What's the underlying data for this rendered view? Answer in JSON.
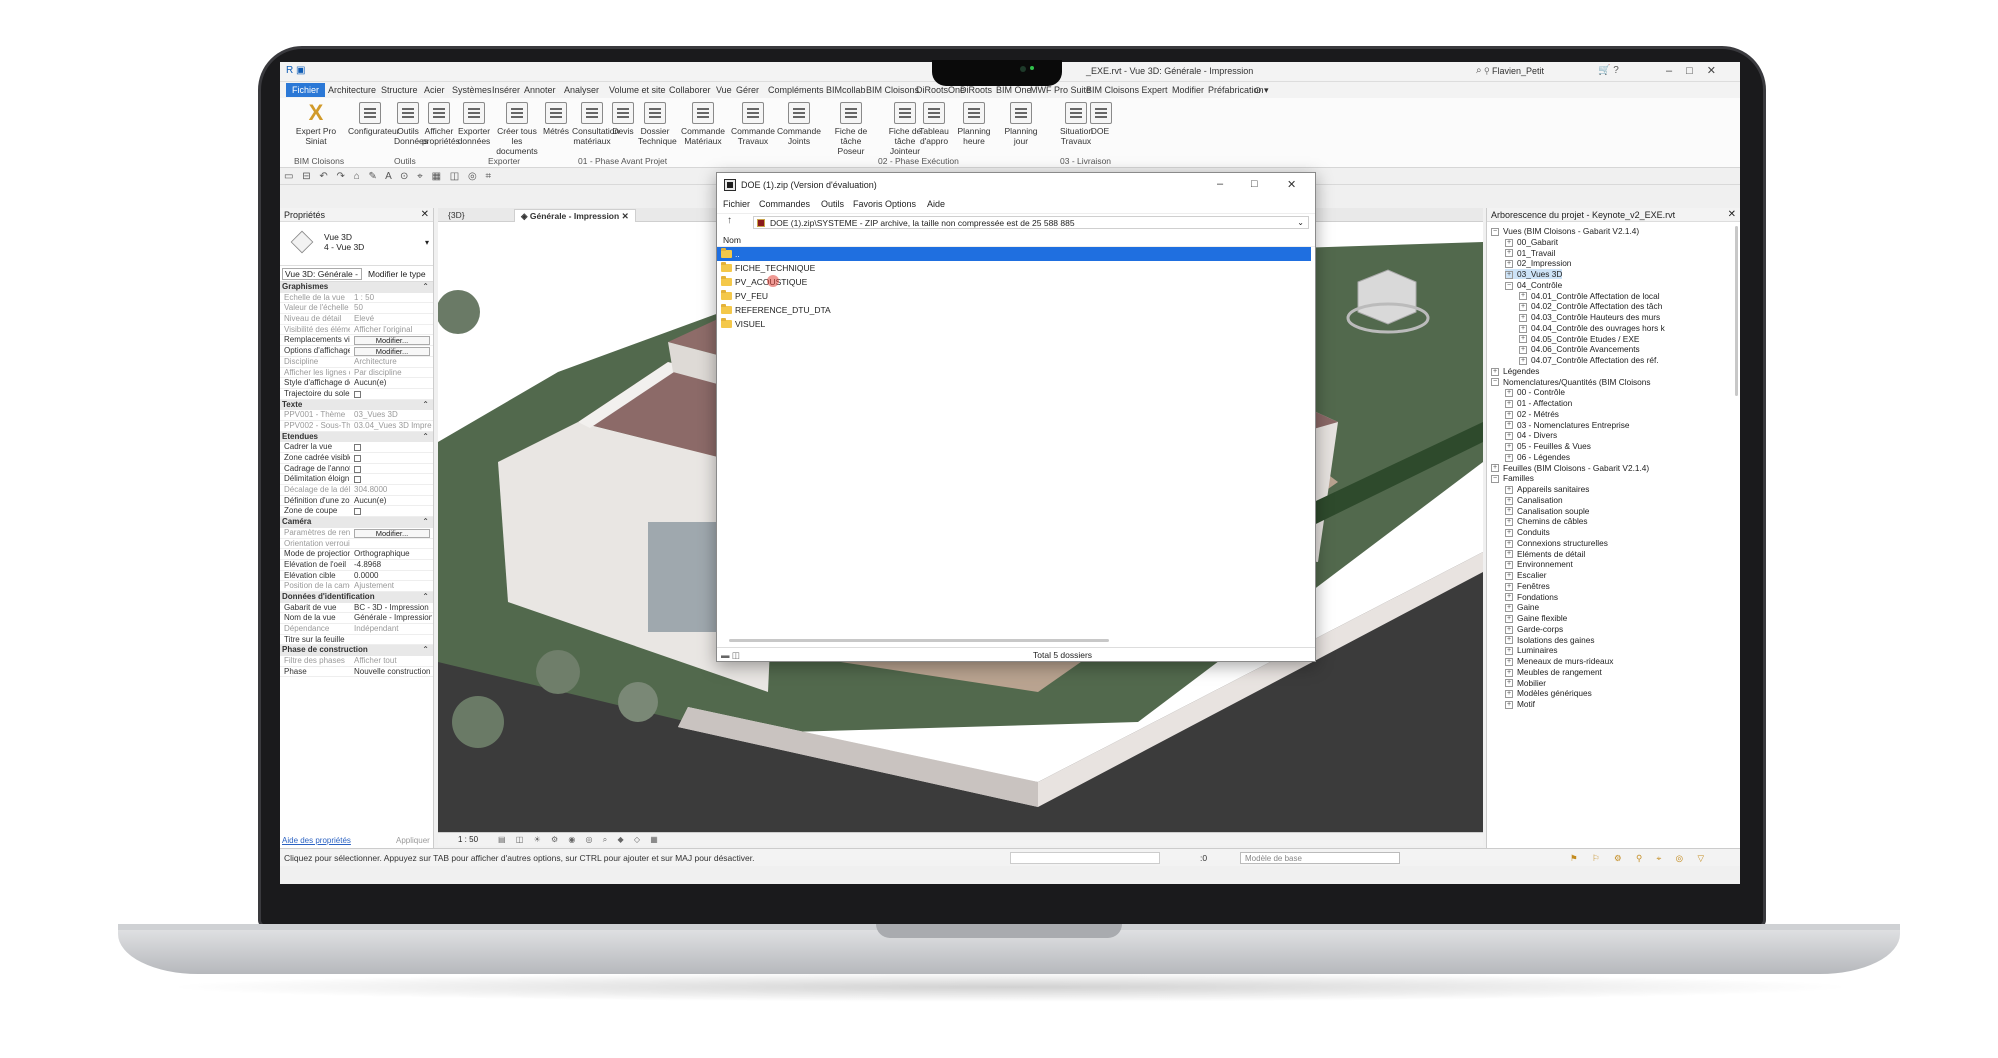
{
  "window": {
    "doc_title": "_EXE.rvt - Vue 3D: Générale - Impression",
    "user": "Flavien_Petit"
  },
  "ribbon_tabs": [
    "Fichier",
    "Architecture",
    "Structure",
    "Acier",
    "Systèmes",
    "Insérer",
    "Annoter",
    "Analyser",
    "Volume et site",
    "Collaborer",
    "Vue",
    "Gérer",
    "Compléments",
    "BIMcollab",
    "BIM Cloisons",
    "DiRootsOne",
    "DiRoots",
    "BIM One",
    "MWF Pro Suite",
    "BIM Cloisons Expert",
    "Modifier",
    "Préfabrication"
  ],
  "ribbon_buttons": [
    {
      "label": "Expert Pro Siniat",
      "label2": ""
    },
    {
      "label": "Configurateur",
      "label2": ""
    },
    {
      "label": "Outils",
      "label2": "Données"
    },
    {
      "label": "Afficher",
      "label2": "propriétés"
    },
    {
      "label": "Exporter",
      "label2": "données"
    },
    {
      "label": "Créer tous",
      "label2": "les documents"
    },
    {
      "label": "Métrés",
      "label2": ""
    },
    {
      "label": "Consultation",
      "label2": "matériaux"
    },
    {
      "label": "Devis",
      "label2": ""
    },
    {
      "label": "Dossier",
      "label2": "Technique"
    },
    {
      "label": "Commande",
      "label2": "Matériaux"
    },
    {
      "label": "Commande",
      "label2": "Travaux"
    },
    {
      "label": "Commande",
      "label2": "Joints"
    },
    {
      "label": "Fiche de tâche",
      "label2": "Poseur"
    },
    {
      "label": "Fiche de tâche",
      "label2": "Jointeur"
    },
    {
      "label": "Tableau",
      "label2": "d'appro"
    },
    {
      "label": "Planning heure",
      "label2": ""
    },
    {
      "label": "Planning jour",
      "label2": ""
    },
    {
      "label": "Situation",
      "label2": "Travaux"
    },
    {
      "label": "DOE",
      "label2": ""
    }
  ],
  "ribbon_groups": [
    "BIM Cloisons",
    "Outils",
    "Exporter",
    "01 - Phase Avant Projet",
    "02 - Phase Exécution",
    "03 - Livraison"
  ],
  "properties": {
    "title": "Propriétés",
    "type_line1": "Vue 3D",
    "type_line2": "4 - Vue 3D",
    "view_select": "Vue 3D: Générale - Im",
    "edit_type": "Modifier le type",
    "rows": [
      {
        "kind": "sec",
        "k": "Graphismes"
      },
      {
        "kind": "dim",
        "k": "Echelle de la vue",
        "v": "1 : 50"
      },
      {
        "kind": "dim",
        "k": "Valeur de l'échelle",
        "v": "50"
      },
      {
        "kind": "dim",
        "k": "Niveau de détail",
        "v": "Elevé"
      },
      {
        "kind": "dim",
        "k": "Visibilité des éléme...",
        "v": "Afficher l'original"
      },
      {
        "kind": "btn",
        "k": "Remplacements vis...",
        "v": "Modifier..."
      },
      {
        "kind": "btn",
        "k": "Options d'affichage...",
        "v": "Modifier..."
      },
      {
        "kind": "dim",
        "k": "Discipline",
        "v": "Architecture"
      },
      {
        "kind": "dim",
        "k": "Afficher les lignes c...",
        "v": "Par discipline"
      },
      {
        "kind": "txt",
        "k": "Style d'affichage de ...",
        "v": "Aucun(e)"
      },
      {
        "kind": "cb",
        "k": "Trajectoire du soleil",
        "v": ""
      },
      {
        "kind": "sec",
        "k": "Texte"
      },
      {
        "kind": "dim",
        "k": "PPV001 - Thème",
        "v": "03_Vues 3D"
      },
      {
        "kind": "dim",
        "k": "PPV002 - Sous-Thè...",
        "v": "03.04_Vues 3D Impre..."
      },
      {
        "kind": "sec",
        "k": "Etendues"
      },
      {
        "kind": "cb",
        "k": "Cadrer la vue",
        "v": ""
      },
      {
        "kind": "cb",
        "k": "Zone cadrée visible",
        "v": ""
      },
      {
        "kind": "cb",
        "k": "Cadrage de l'annot...",
        "v": ""
      },
      {
        "kind": "cb",
        "k": "Délimitation éloign...",
        "v": ""
      },
      {
        "kind": "dim",
        "k": "Décalage de la déli...",
        "v": "304.8000"
      },
      {
        "kind": "txt",
        "k": "Définition d'une zone ...",
        "v": "Aucun(e)"
      },
      {
        "kind": "cb",
        "k": "Zone de coupe",
        "v": ""
      },
      {
        "kind": "sec",
        "k": "Caméra"
      },
      {
        "kind": "dimbtn",
        "k": "Paramètres de rendu",
        "v": "Modifier..."
      },
      {
        "kind": "dim",
        "k": "Orientation verrouil...",
        "v": ""
      },
      {
        "kind": "txt",
        "k": "Mode de projection",
        "v": "Orthographique"
      },
      {
        "kind": "txt",
        "k": "Elévation de l'oeil",
        "v": "-4.8968"
      },
      {
        "kind": "txt",
        "k": "Elévation cible",
        "v": "0.0000"
      },
      {
        "kind": "dim",
        "k": "Position de la caméra",
        "v": "Ajustement"
      },
      {
        "kind": "sec",
        "k": "Données d'identification"
      },
      {
        "kind": "txt",
        "k": "Gabarit de vue",
        "v": "BC - 3D - Impression"
      },
      {
        "kind": "txt",
        "k": "Nom de la vue",
        "v": "Générale - Impression"
      },
      {
        "kind": "dim",
        "k": "Dépendance",
        "v": "Indépendant"
      },
      {
        "kind": "txt",
        "k": "Titre sur la feuille",
        "v": ""
      },
      {
        "kind": "sec",
        "k": "Phase de construction"
      },
      {
        "kind": "dim",
        "k": "Filtre des phases",
        "v": "Afficher tout"
      },
      {
        "kind": "txt",
        "k": "Phase",
        "v": "Nouvelle construction"
      }
    ],
    "help_link": "Aide des propriétés",
    "apply": "Appliquer"
  },
  "view_tabs": [
    {
      "label": "{3D}",
      "active": false
    },
    {
      "label": "Générale - Impression",
      "active": true
    }
  ],
  "view_scale": "1 : 50",
  "browser": {
    "title": "Arborescence du projet - Keynote_v2_EXE.rvt",
    "items": [
      {
        "label": "Vues (BIM Cloisons - Gabarit V2.1.4)",
        "level": 0,
        "exp": "−"
      },
      {
        "label": "00_Gabarit",
        "level": 1,
        "exp": "+"
      },
      {
        "label": "01_Travail",
        "level": 1,
        "exp": "+"
      },
      {
        "label": "02_Impression",
        "level": 1,
        "exp": "+"
      },
      {
        "label": "03_Vues 3D",
        "level": 1,
        "exp": "+",
        "sel": true
      },
      {
        "label": "04_Contrôle",
        "level": 1,
        "exp": "−"
      },
      {
        "label": "04.01_Contrôle Affectation de local",
        "level": 2,
        "exp": "+"
      },
      {
        "label": "04.02_Contrôle Affectation des tâch",
        "level": 2,
        "exp": "+"
      },
      {
        "label": "04.03_Contrôle Hauteurs des murs",
        "level": 2,
        "exp": "+"
      },
      {
        "label": "04.04_Contrôle des ouvrages hors k",
        "level": 2,
        "exp": "+"
      },
      {
        "label": "04.05_Contrôle Etudes / EXE",
        "level": 2,
        "exp": "+"
      },
      {
        "label": "04.06_Contrôle Avancements",
        "level": 2,
        "exp": "+"
      },
      {
        "label": "04.07_Contrôle Affectation des réf.",
        "level": 2,
        "exp": "+"
      },
      {
        "label": "Légendes",
        "level": 0,
        "exp": "+"
      },
      {
        "label": "Nomenclatures/Quantités (BIM Cloisons",
        "level": 0,
        "exp": "−"
      },
      {
        "label": "00 - Contrôle",
        "level": 1,
        "exp": "+"
      },
      {
        "label": "01 - Affectation",
        "level": 1,
        "exp": "+"
      },
      {
        "label": "02 - Métrés",
        "level": 1,
        "exp": "+"
      },
      {
        "label": "03 - Nomenclatures Entreprise",
        "level": 1,
        "exp": "+"
      },
      {
        "label": "04 - Divers",
        "level": 1,
        "exp": "+"
      },
      {
        "label": "05 - Feuilles & Vues",
        "level": 1,
        "exp": "+"
      },
      {
        "label": "06 - Légendes",
        "level": 1,
        "exp": "+"
      },
      {
        "label": "Feuilles (BIM Cloisons - Gabarit V2.1.4)",
        "level": 0,
        "exp": "+"
      },
      {
        "label": "Familles",
        "level": 0,
        "exp": "−"
      },
      {
        "label": "Appareils sanitaires",
        "level": 1,
        "exp": "+"
      },
      {
        "label": "Canalisation",
        "level": 1,
        "exp": "+"
      },
      {
        "label": "Canalisation souple",
        "level": 1,
        "exp": "+"
      },
      {
        "label": "Chemins de câbles",
        "level": 1,
        "exp": "+"
      },
      {
        "label": "Conduits",
        "level": 1,
        "exp": "+"
      },
      {
        "label": "Connexions structurelles",
        "level": 1,
        "exp": "+"
      },
      {
        "label": "Eléments de détail",
        "level": 1,
        "exp": "+"
      },
      {
        "label": "Environnement",
        "level": 1,
        "exp": "+"
      },
      {
        "label": "Escalier",
        "level": 1,
        "exp": "+"
      },
      {
        "label": "Fenêtres",
        "level": 1,
        "exp": "+"
      },
      {
        "label": "Fondations",
        "level": 1,
        "exp": "+"
      },
      {
        "label": "Gaine",
        "level": 1,
        "exp": "+"
      },
      {
        "label": "Gaine flexible",
        "level": 1,
        "exp": "+"
      },
      {
        "label": "Garde-corps",
        "level": 1,
        "exp": "+"
      },
      {
        "label": "Isolations des gaines",
        "level": 1,
        "exp": "+"
      },
      {
        "label": "Luminaires",
        "level": 1,
        "exp": "+"
      },
      {
        "label": "Meneaux de murs-rideaux",
        "level": 1,
        "exp": "+"
      },
      {
        "label": "Meubles de rangement",
        "level": 1,
        "exp": "+"
      },
      {
        "label": "Mobilier",
        "level": 1,
        "exp": "+"
      },
      {
        "label": "Modèles génériques",
        "level": 1,
        "exp": "+"
      },
      {
        "label": "Motif",
        "level": 1,
        "exp": "+"
      }
    ]
  },
  "status": {
    "message": "Cliquez pour sélectionner. Appuyez sur TAB pour afficher d'autres options, sur CTRL pour ajouter et sur MAJ pour désactiver.",
    "zero": ":0",
    "model": "Modèle de base"
  },
  "zip": {
    "title": "DOE (1).zip (Version d'évaluation)",
    "menu": [
      "Fichier",
      "Commandes",
      "Outils",
      "Favoris",
      "Options",
      "Aide"
    ],
    "path": "DOE (1).zip\\SYSTEME - ZIP archive, la taille non compressée est de 25 588 885",
    "column": "Nom",
    "rows": [
      "..",
      "FICHE_TECHNIQUE",
      "PV_ACOUSTIQUE",
      "PV_FEU",
      "REFERENCE_DTU_DTA",
      "VISUEL"
    ],
    "total": "Total 5 dossiers"
  },
  "colors": {
    "accent": "#2b78d6",
    "selection": "#1f6fe0",
    "folder": "#f4c84a"
  }
}
